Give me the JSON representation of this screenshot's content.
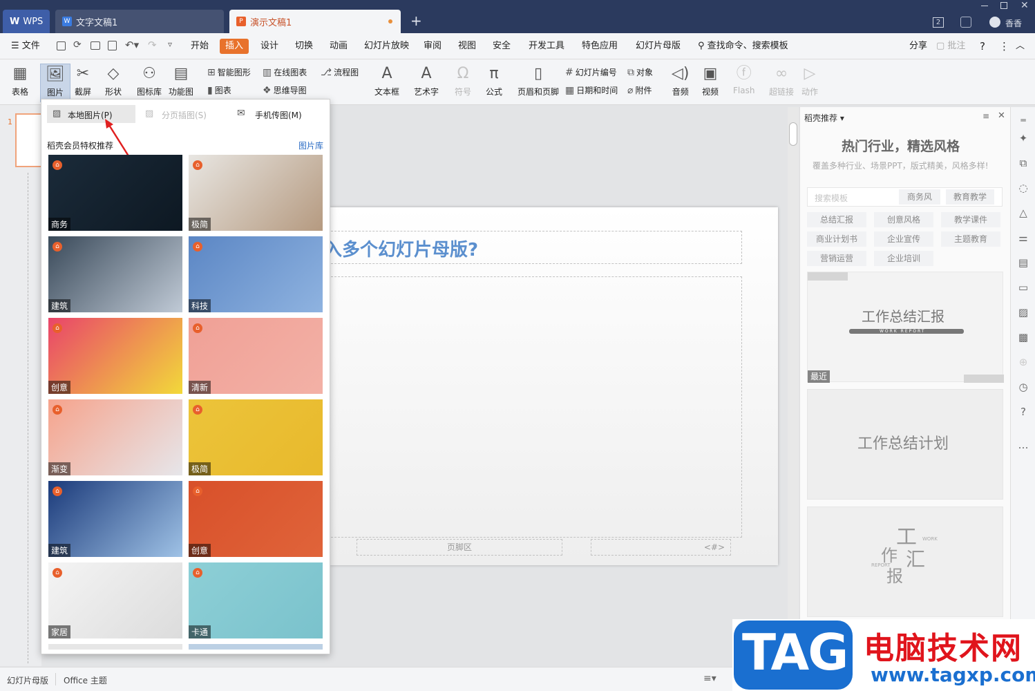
{
  "tabs": {
    "wps": "WPS",
    "doc": "文字文稿1",
    "ppt": "演示文稿1",
    "new_tab": "+",
    "user": "香香",
    "badge": "2"
  },
  "menu": {
    "file": "文件",
    "items": [
      "开始",
      "插入",
      "设计",
      "切换",
      "动画",
      "幻灯片放映",
      "审阅",
      "视图",
      "安全",
      "开发工具",
      "特色应用",
      "幻灯片母版"
    ],
    "search": "查找命令、搜索模板",
    "share": "分享",
    "comment": "批注",
    "help": "?"
  },
  "ribbon": {
    "table": "表格",
    "picture": "图片",
    "screenshot": "截屏",
    "shape": "形状",
    "icon_lib": "图标库",
    "func_chart": "功能图",
    "smart_shape": "智能图形",
    "online_chart": "在线图表",
    "flowchart": "流程图",
    "chart": "图表",
    "mindmap": "思维导图",
    "textbox": "文本框",
    "wordart": "艺术字",
    "symbol": "符号",
    "formula": "公式",
    "header_footer": "页眉和页脚",
    "slide_number": "幻灯片编号",
    "object": "对象",
    "datetime": "日期和时间",
    "attachment": "附件",
    "audio": "音频",
    "video": "视频",
    "flash": "Flash",
    "hyperlink": "超链接",
    "action": "动作"
  },
  "popup": {
    "local_picture": "本地图片(P)",
    "page_picture": "分页插图(S)",
    "phone_picture": "手机传图(M)",
    "section_title": "稻壳会员特权推荐",
    "library_link": "图片库",
    "images": [
      {
        "label": "商务",
        "colors": [
          "#1b2b3a",
          "#0d1822"
        ]
      },
      {
        "label": "极简",
        "colors": [
          "#e8e6e2",
          "#b59a80"
        ]
      },
      {
        "label": "建筑",
        "colors": [
          "#3a4a5a",
          "#c0cad6"
        ]
      },
      {
        "label": "科技",
        "colors": [
          "#5b86c4",
          "#8fb3e0"
        ]
      },
      {
        "label": "创意",
        "colors": [
          "#e9446a",
          "#f2d93a"
        ]
      },
      {
        "label": "清新",
        "colors": [
          "#f0a096",
          "#f3b1a6"
        ]
      },
      {
        "label": "渐变",
        "colors": [
          "#f6a38c",
          "#e6e6ea"
        ]
      },
      {
        "label": "极简",
        "colors": [
          "#ecc43a",
          "#e8b92c"
        ]
      },
      {
        "label": "建筑",
        "colors": [
          "#1b3a7a",
          "#9fc2e6"
        ]
      },
      {
        "label": "创意",
        "colors": [
          "#d8502a",
          "#e0643a"
        ]
      },
      {
        "label": "家居",
        "colors": [
          "#f4f4f4",
          "#dcdcdc"
        ]
      },
      {
        "label": "卡通",
        "colors": [
          "#8dcfd6",
          "#7ac2cc"
        ]
      }
    ],
    "badge_glyph": "⌂"
  },
  "slide": {
    "title_fragment": "入多个幻灯片母版?",
    "footer": "页脚区",
    "number": "<#>",
    "thumb_index": "1"
  },
  "right_pane": {
    "header": "稻壳推荐",
    "headline": "热门行业，精选风格",
    "subline": "覆盖多种行业、场景PPT，版式精美，风格多样!",
    "search_placeholder": "搜索模板",
    "search_tags": [
      "商务风",
      "教育教学"
    ],
    "tags": [
      "总结汇报",
      "创意风格",
      "教学课件",
      "商业计划书",
      "企业宣传",
      "主题教育",
      "营销运营",
      "企业培训"
    ],
    "card1_title": "工作总结汇报",
    "card1_sub": "WORK REPORT",
    "card1_label": "最近",
    "card2_title": "工作总结计划",
    "card3_chars": [
      "工",
      "作",
      "汇",
      "报"
    ],
    "card3_words": [
      "WORK",
      "REPORT"
    ]
  },
  "status": {
    "master": "幻灯片母版",
    "theme": "Office 主题"
  },
  "watermark": {
    "tag": "TAG",
    "cn": "电脑技术网",
    "url": "www.tagxp.com"
  },
  "colors": {
    "accent": "#e8722c",
    "title_blue": "#5b8fce",
    "link_blue": "#2b6cc4",
    "tabbar": "#2b3a5e"
  }
}
